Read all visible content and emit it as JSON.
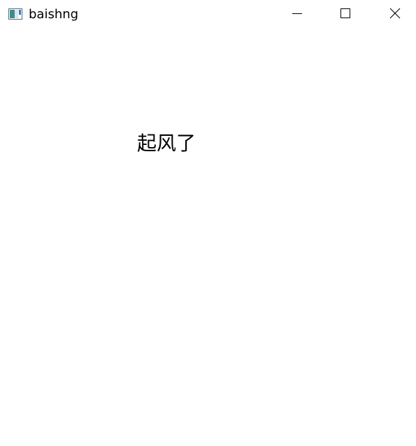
{
  "window": {
    "title": "baishng",
    "icon": "app-window-icon",
    "controls": {
      "minimize_icon": "minimize-icon",
      "maximize_icon": "maximize-icon",
      "close_icon": "close-icon"
    }
  },
  "content": {
    "label": "起风了"
  }
}
